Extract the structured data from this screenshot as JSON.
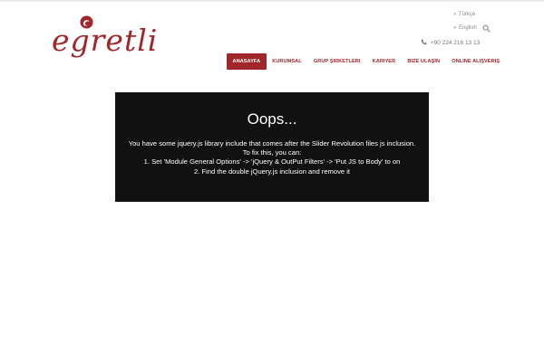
{
  "brand": {
    "logo_text": "egretli",
    "color": "#a1262a"
  },
  "header": {
    "languages": [
      {
        "label": "Türkçe",
        "bullet": "»",
        "icon": "chevron-right-icon"
      },
      {
        "label": "English",
        "bullet": "»",
        "icon": "chevron-right-icon"
      }
    ],
    "phone": "+90 224 216 13 13",
    "phone_icon": "phone-icon",
    "search_icon": "search-icon"
  },
  "nav": {
    "items": [
      {
        "label": "ANASAYFA",
        "active": true
      },
      {
        "label": "KURUMSAL",
        "active": false
      },
      {
        "label": "GRUP ŞIRKETLERI",
        "active": false
      },
      {
        "label": "KARIYER",
        "active": false
      },
      {
        "label": "BIZE ULAŞIN",
        "active": false
      },
      {
        "label": "ONLINE ALIŞVERIŞ",
        "active": false
      }
    ],
    "active_bg": "#a1262a"
  },
  "error": {
    "title": "Oops...",
    "lines": [
      "You have some jquery.js library include that comes after the Slider Revolution files js inclusion.",
      "To fix this, you can:",
      "1. Set 'Module General Options' -> 'jQuery & OutPut Filters' -> 'Put JS to Body' to on",
      "2. Find the double jQuery.js inclusion and remove it"
    ],
    "background": "#111111"
  }
}
